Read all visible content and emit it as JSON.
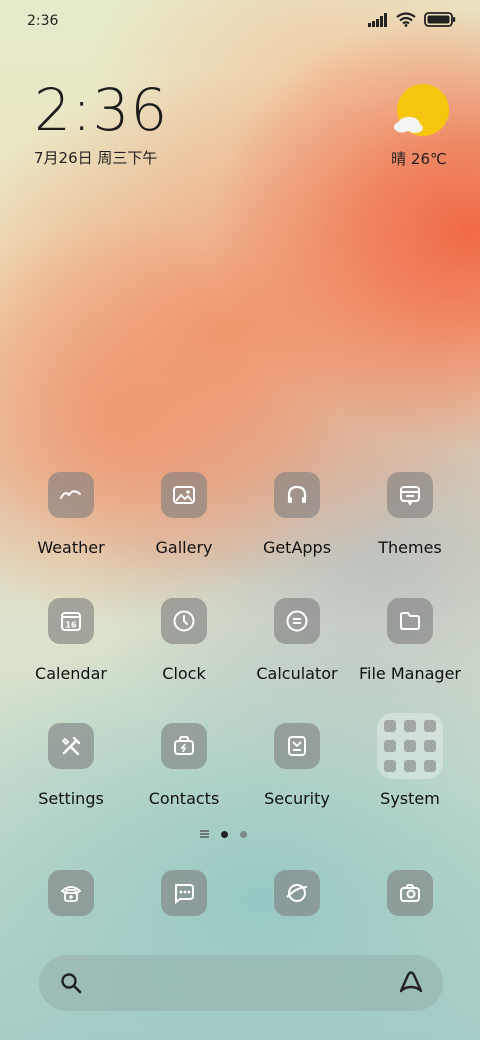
{
  "status": {
    "time": "2:36"
  },
  "clock": {
    "time": "2:36",
    "date": "7月26日 周三下午"
  },
  "weather": {
    "text": "晴 26℃"
  },
  "apps": [
    {
      "label": "Weather"
    },
    {
      "label": "Gallery"
    },
    {
      "label": "GetApps"
    },
    {
      "label": "Themes"
    },
    {
      "label": "Calendar",
      "icon_text": "16"
    },
    {
      "label": "Clock"
    },
    {
      "label": "Calculator"
    },
    {
      "label": "File Manager"
    },
    {
      "label": "Settings"
    },
    {
      "label": "Contacts"
    },
    {
      "label": "Security"
    },
    {
      "label": "System"
    }
  ],
  "dock": [
    {
      "name": "phone"
    },
    {
      "name": "messages"
    },
    {
      "name": "browser"
    },
    {
      "name": "camera"
    }
  ],
  "page_indicator": {
    "pages": 2,
    "current": 1
  }
}
